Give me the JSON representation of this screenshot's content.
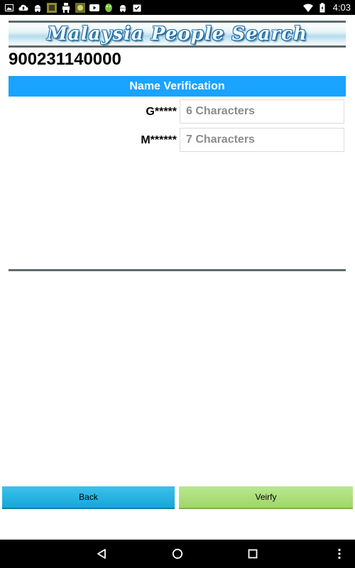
{
  "status_bar": {
    "time": "4:03",
    "left_icons": [
      "image-icon",
      "cloud-upload-icon",
      "android-icon",
      "app-icon",
      "robot-icon",
      "app-icon",
      "youtube-icon",
      "android-icon",
      "android-icon",
      "checklist-icon"
    ],
    "right_icons": [
      "wifi-icon",
      "battery-charging-icon"
    ]
  },
  "banner": {
    "title": "Malaysia People Search"
  },
  "header": {
    "id_number": "900231140000"
  },
  "section": {
    "title": "Name Verification"
  },
  "fields": [
    {
      "label": "G*****",
      "placeholder": "6 Characters",
      "value": ""
    },
    {
      "label": "M******",
      "placeholder": "7 Characters",
      "value": ""
    }
  ],
  "buttons": {
    "back_label": "Back",
    "verify_label": "Veirfy"
  },
  "colors": {
    "section_header": "#1aa3ff",
    "back_button": "#18a6d6",
    "verify_button": "#9fd66a",
    "divider": "#5d6b6b"
  }
}
